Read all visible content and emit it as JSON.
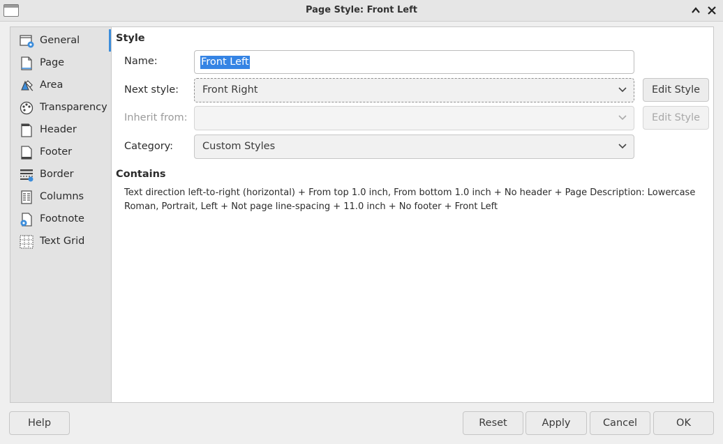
{
  "window": {
    "title": "Page Style: Front Left",
    "icons": {
      "app": "window-icon",
      "maximize": "chevron-up-icon",
      "close": "close-icon"
    },
    "maximize_glyph": "⌃",
    "close_glyph": "✕"
  },
  "sidebar": {
    "items": [
      {
        "label": "General",
        "icon": "general-icon"
      },
      {
        "label": "Page",
        "icon": "page-icon"
      },
      {
        "label": "Area",
        "icon": "area-icon"
      },
      {
        "label": "Transparency",
        "icon": "transparency-icon"
      },
      {
        "label": "Header",
        "icon": "header-icon"
      },
      {
        "label": "Footer",
        "icon": "footer-icon"
      },
      {
        "label": "Border",
        "icon": "border-icon"
      },
      {
        "label": "Columns",
        "icon": "columns-icon"
      },
      {
        "label": "Footnote",
        "icon": "footnote-icon"
      },
      {
        "label": "Text Grid",
        "icon": "text-grid-icon"
      }
    ]
  },
  "style": {
    "section_title": "Style",
    "name_label": "Name:",
    "name_value": "Front Left",
    "next_style_label": "Next style:",
    "next_style_value": "Front Right",
    "inherit_label": "Inherit from:",
    "inherit_value": "",
    "category_label": "Category:",
    "category_value": "Custom Styles",
    "edit_style_label": "Edit Style"
  },
  "contains": {
    "title": "Contains",
    "description": "Text direction left-to-right (horizontal) + From top 1.0 inch, From bottom 1.0 inch + No header + Page Description: Lowercase Roman, Portrait, Left + Not page line-spacing + 11.0 inch + No footer + Front Left"
  },
  "buttons": {
    "help": "Help",
    "reset": "Reset",
    "apply": "Apply",
    "cancel": "Cancel",
    "ok": "OK"
  },
  "colors": {
    "accent": "#3c8ddb",
    "selection": "#3584e4"
  }
}
